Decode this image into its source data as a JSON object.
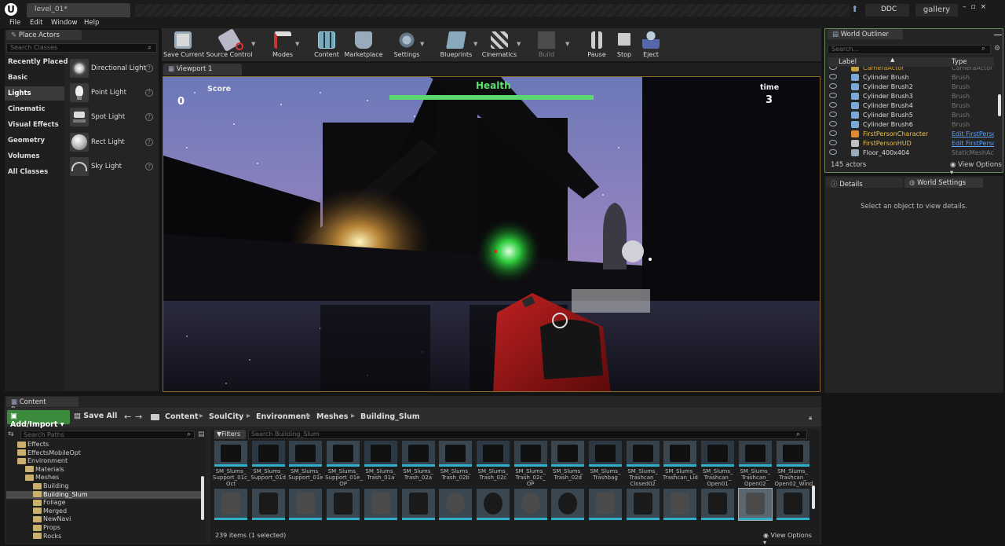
{
  "app": {
    "document_tab": "level_01*",
    "ddc_label": "DDC",
    "gallery_label": "gallery",
    "window_controls": "–▫×"
  },
  "menu": [
    "File",
    "Edit",
    "Window",
    "Help"
  ],
  "place_actors": {
    "tab": "Place Actors",
    "search_placeholder": "Search Classes",
    "categories": [
      "Recently Placed",
      "Basic",
      "Lights",
      "Cinematic",
      "Visual Effects",
      "Geometry",
      "Volumes",
      "All Classes"
    ],
    "selected_category": "Lights",
    "items": [
      {
        "label": "Directional Light",
        "icon": "directional-light-icon"
      },
      {
        "label": "Point Light",
        "icon": "point-light-icon"
      },
      {
        "label": "Spot Light",
        "icon": "spot-light-icon"
      },
      {
        "label": "Rect Light",
        "icon": "rect-light-icon"
      },
      {
        "label": "Sky Light",
        "icon": "sky-light-icon"
      }
    ],
    "help_glyph": "?"
  },
  "toolbar": [
    {
      "label": "Save Current",
      "icon": "save-icon"
    },
    {
      "label": "Source Control",
      "icon": "source-control-icon"
    },
    {
      "label": "Modes",
      "icon": "modes-icon"
    },
    {
      "label": "Content",
      "icon": "content-icon"
    },
    {
      "label": "Marketplace",
      "icon": "marketplace-icon"
    },
    {
      "label": "Settings",
      "icon": "settings-icon"
    },
    {
      "label": "Blueprints",
      "icon": "blueprints-icon"
    },
    {
      "label": "Cinematics",
      "icon": "cinematics-icon"
    },
    {
      "label": "Build",
      "icon": "build-icon"
    },
    {
      "label": "Pause",
      "icon": "pause-icon"
    },
    {
      "label": "Stop",
      "icon": "stop-icon"
    },
    {
      "label": "Eject",
      "icon": "eject-icon"
    }
  ],
  "viewport": {
    "tab": "Viewport 1",
    "hud": {
      "score_label": "Score",
      "score_value": "0",
      "health_label": "Health",
      "health_fraction": 1.0,
      "time_label": "time",
      "time_value": "3"
    }
  },
  "world_outliner": {
    "tab": "World Outliner",
    "search_placeholder": "Search...",
    "col_label": "Label",
    "col_type": "Type",
    "rows": [
      {
        "label": "CameraActor",
        "type": "CameraActor",
        "link": false
      },
      {
        "label": "Cylinder Brush",
        "type": "Brush",
        "link": false
      },
      {
        "label": "Cylinder Brush2",
        "type": "Brush",
        "link": false
      },
      {
        "label": "Cylinder Brush3",
        "type": "Brush",
        "link": false
      },
      {
        "label": "Cylinder Brush4",
        "type": "Brush",
        "link": false
      },
      {
        "label": "Cylinder Brush5",
        "type": "Brush",
        "link": false
      },
      {
        "label": "Cylinder Brush6",
        "type": "Brush",
        "link": false
      },
      {
        "label": "FirstPersonCharacter",
        "type": "Edit FirstPerson",
        "link": true
      },
      {
        "label": "FirstPersonHUD",
        "type": "Edit FirstPerson",
        "link": true
      },
      {
        "label": "Floor_400x404",
        "type": "StaticMeshActor",
        "link": false
      }
    ],
    "actor_count": "145 actors",
    "view_options": "View Options"
  },
  "details": {
    "tab": "Details",
    "world_settings_tab": "World Settings",
    "empty_message": "Select an object to view details."
  },
  "content_browser": {
    "tab": "Content Browser",
    "add_import": "Add/Import",
    "save_all": "Save All",
    "breadcrumbs": [
      "Content",
      "SoulCity",
      "Environment",
      "Meshes",
      "Building_Slum"
    ],
    "path_search_placeholder": "Search Paths",
    "filters_label": "Filters",
    "asset_search_placeholder": "Search Building_Slum",
    "tree": [
      {
        "label": "Effects",
        "depth": 1,
        "selected": false
      },
      {
        "label": "EffectsMobileOpt",
        "depth": 1,
        "selected": false
      },
      {
        "label": "Environment",
        "depth": 1,
        "selected": false
      },
      {
        "label": "Materials",
        "depth": 2,
        "selected": false
      },
      {
        "label": "Meshes",
        "depth": 2,
        "selected": false
      },
      {
        "label": "Building",
        "depth": 3,
        "selected": false
      },
      {
        "label": "Building_Slum",
        "depth": 3,
        "selected": true
      },
      {
        "label": "Foliage",
        "depth": 3,
        "selected": false
      },
      {
        "label": "Merged",
        "depth": 3,
        "selected": false
      },
      {
        "label": "NewNavi",
        "depth": 3,
        "selected": false
      },
      {
        "label": "Props",
        "depth": 3,
        "selected": false
      },
      {
        "label": "Rocks",
        "depth": 3,
        "selected": false
      }
    ],
    "assets_row1": [
      "SM_Slums_ Support_01c_ Oct",
      "SM_Slums_ Support_01d",
      "SM_Slums_ Support_01e",
      "SM_Slums_ Support_01e_ OP",
      "SM_Slums_ Trash_01a",
      "SM_Slums_ Trash_02a",
      "SM_Slums_ Trash_02b",
      "SM_Slums_ Trash_02c",
      "SM_Slums_ Trash_02c_ OP",
      "SM_Slums_ Trash_02d",
      "SM_Slums_ Trashbag",
      "SM_Slums_ Trashcan_ Closed02",
      "SM_Slums_ Trashcan_Lid",
      "SM_Slums_ Trashcan_ Open01",
      "SM_Slums_ Trashcan_ Open02",
      "SM_Slums_ Trashcan_ Open02_Wind"
    ],
    "row2_count": 16,
    "items_status": "239 items (1 selected)",
    "view_options": "View Options"
  }
}
